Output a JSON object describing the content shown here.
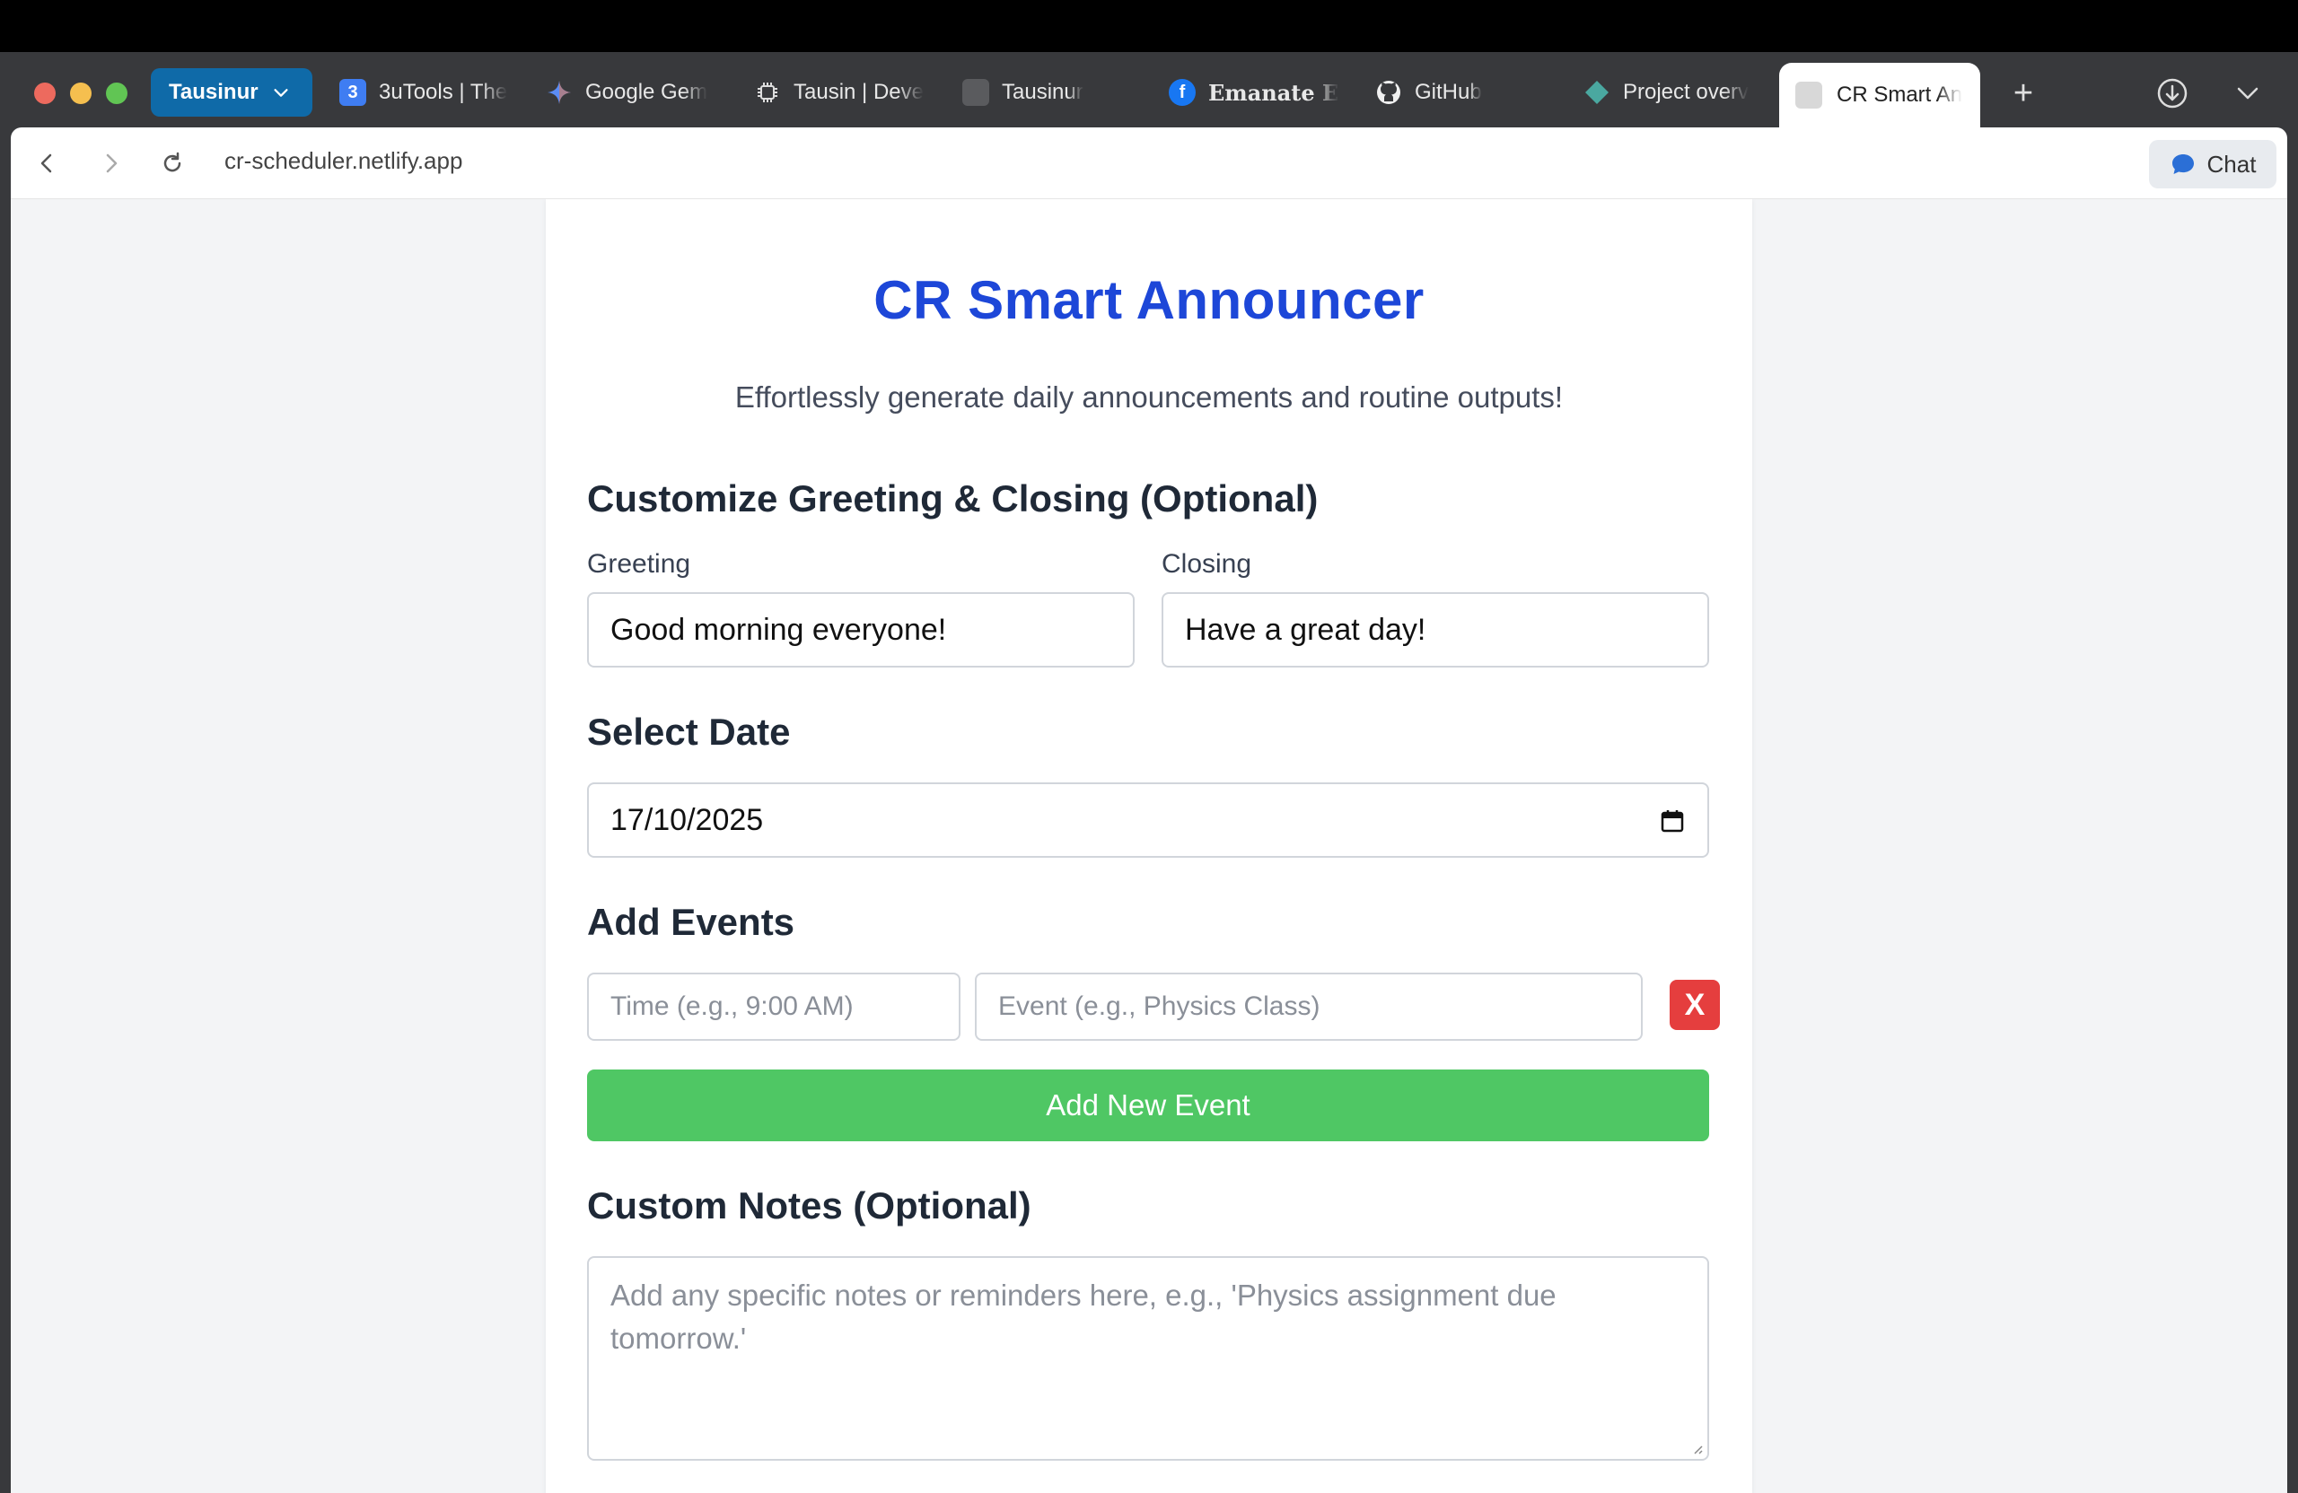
{
  "browser": {
    "profile_label": "Tausinur",
    "tabs": [
      {
        "label": "3uTools | The",
        "icon": "3utools-icon"
      },
      {
        "label": "Google Gem",
        "icon": "gemini-icon"
      },
      {
        "label": "Tausin | Deve",
        "icon": "chip-icon"
      },
      {
        "label": "Tausinur",
        "icon": "blank-page-icon"
      },
      {
        "label": "Emanate Exc",
        "icon": "facebook-icon"
      },
      {
        "label": "GitHub",
        "icon": "github-icon"
      },
      {
        "label": "Project overv",
        "icon": "diamond-icon"
      }
    ],
    "active_tab": {
      "label": "CR Smart An",
      "icon": "blank-page-icon"
    },
    "url": "cr-scheduler.netlify.app",
    "chat_label": "Chat",
    "accent_color": "#0f6aa8"
  },
  "app": {
    "title": "CR Smart Announcer",
    "subtitle": "Effortlessly generate daily announcements and routine outputs!",
    "greeting_section": {
      "heading": "Customize Greeting & Closing (Optional)",
      "greeting_label": "Greeting",
      "greeting_value": "Good morning everyone!",
      "closing_label": "Closing",
      "closing_value": "Have a great day!"
    },
    "date_section": {
      "heading": "Select Date",
      "date_value": "17/10/2025"
    },
    "events_section": {
      "heading": "Add Events",
      "time_placeholder": "Time (e.g., 9:00 AM)",
      "event_placeholder": "Event (e.g., Physics Class)",
      "remove_label": "X",
      "add_label": "Add New Event"
    },
    "notes_section": {
      "heading": "Custom Notes (Optional)",
      "placeholder": "Add any specific notes or reminders here, e.g., 'Physics assignment due tomorrow.'"
    },
    "colors": {
      "title": "#1d47d8",
      "add_button": "#4fc764",
      "remove_button": "#e53e3e"
    }
  }
}
